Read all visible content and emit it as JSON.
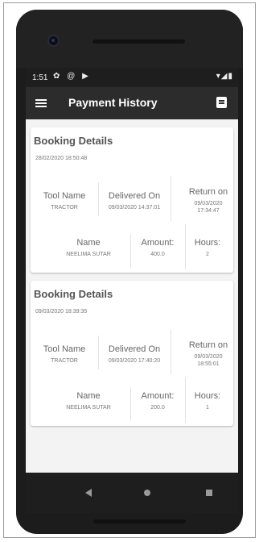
{
  "status_bar": {
    "time": "1:51",
    "left_icons": [
      "settings-icon",
      "at-icon",
      "play-icon"
    ],
    "left_glyphs": "✿ @ ▶",
    "right_glyphs": "▾◢▮"
  },
  "app_bar": {
    "title": "Payment History"
  },
  "bookings": [
    {
      "heading": "Booking Details",
      "date": "28/02/2020 18:50:48",
      "tool_name_label": "Tool Name",
      "tool_name": "TRACTOR",
      "delivered_on_label": "Delivered On",
      "delivered_on": "09/03/2020 14:37:01",
      "return_on_label": "Return on",
      "return_on": "09/03/2020 17:34:47",
      "name_label": "Name",
      "name": "NEELIMA SUTAR",
      "amount_label": "Amount:",
      "amount": "400.0",
      "hours_label": "Hours:",
      "hours": "2"
    },
    {
      "heading": "Booking Details",
      "date": "09/03/2020 18:39:35",
      "tool_name_label": "Tool Name",
      "tool_name": "TRACTOR",
      "delivered_on_label": "Delivered On",
      "delivered_on": "09/03/2020 17:40:20",
      "return_on_label": "Return on",
      "return_on": "09/03/2020 18:55:01",
      "name_label": "Name",
      "name": "NEELIMA SUTAR",
      "amount_label": "Amount:",
      "amount": "200.0",
      "hours_label": "Hours:",
      "hours": "1"
    }
  ],
  "colors": {
    "app_bar": "#2c2c2c",
    "background": "#f3f3f3",
    "card": "#ffffff"
  }
}
